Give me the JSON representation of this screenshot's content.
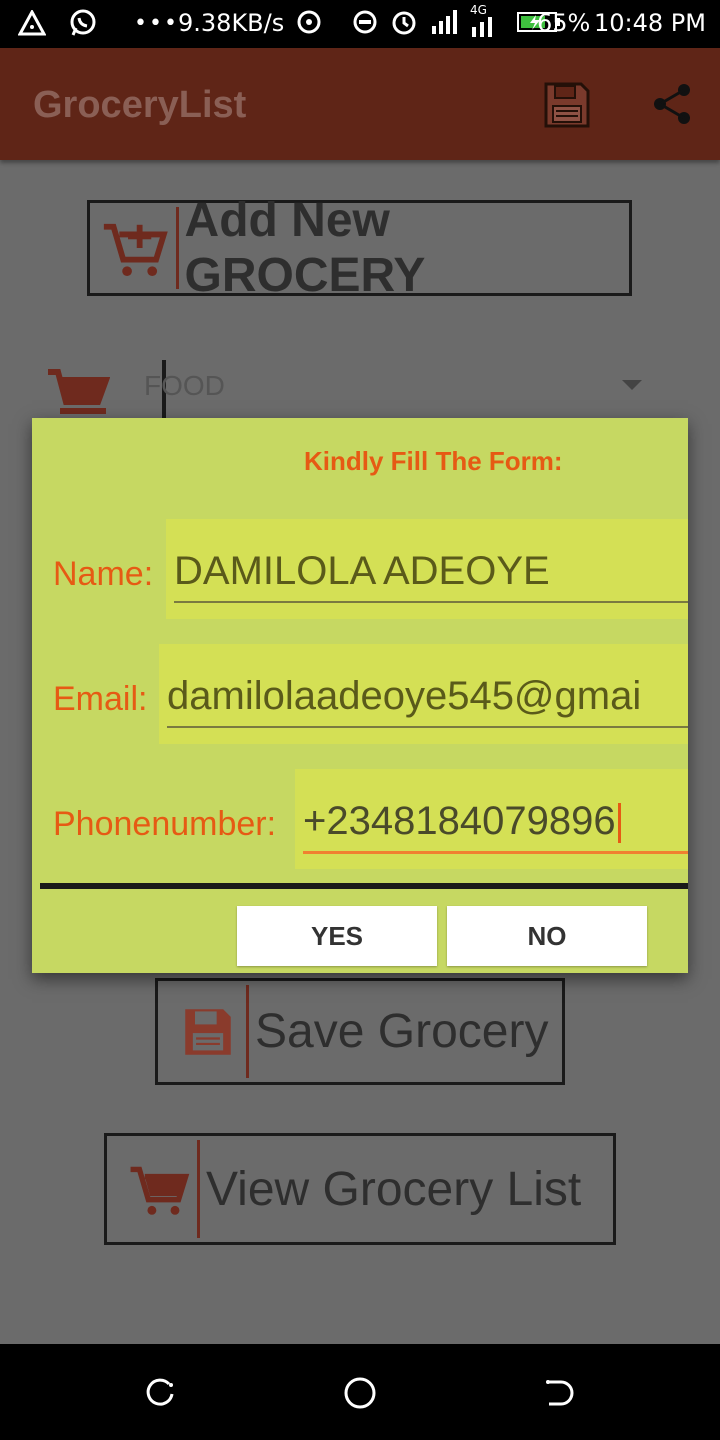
{
  "status_bar": {
    "network_speed": "9.38KB/s",
    "network_type": "4G",
    "battery_percent": "65%",
    "time": "10:48 PM",
    "icons": [
      "alert-triangle-icon",
      "whatsapp-icon",
      "more-dots-icon",
      "hotspot-icon",
      "do-not-disturb-icon",
      "alarm-icon",
      "signal-icon",
      "signal-4g-icon",
      "battery-charging-icon"
    ]
  },
  "app_bar": {
    "title": "GroceryList",
    "actions": [
      "save-icon",
      "share-icon"
    ]
  },
  "main": {
    "add_button_label": "Add New GROCERY",
    "category_value": "FOOD",
    "save_button_label": "Save Grocery",
    "view_button_label": "View Grocery List"
  },
  "dialog": {
    "heading": "Kindly Fill The Form:",
    "name_label": "Name:",
    "name_value": "DAMILOLA ADEOYE",
    "email_label": "Email:",
    "email_value": "damilolaadeoye545@gmai",
    "phone_label": "Phonenumber:",
    "phone_value": "+2348184079896",
    "yes_label": "YES",
    "no_label": "NO"
  },
  "colors": {
    "app_bar": "#5f2517",
    "dialog_bg": "#c6d862",
    "accent": "#e65a14"
  }
}
